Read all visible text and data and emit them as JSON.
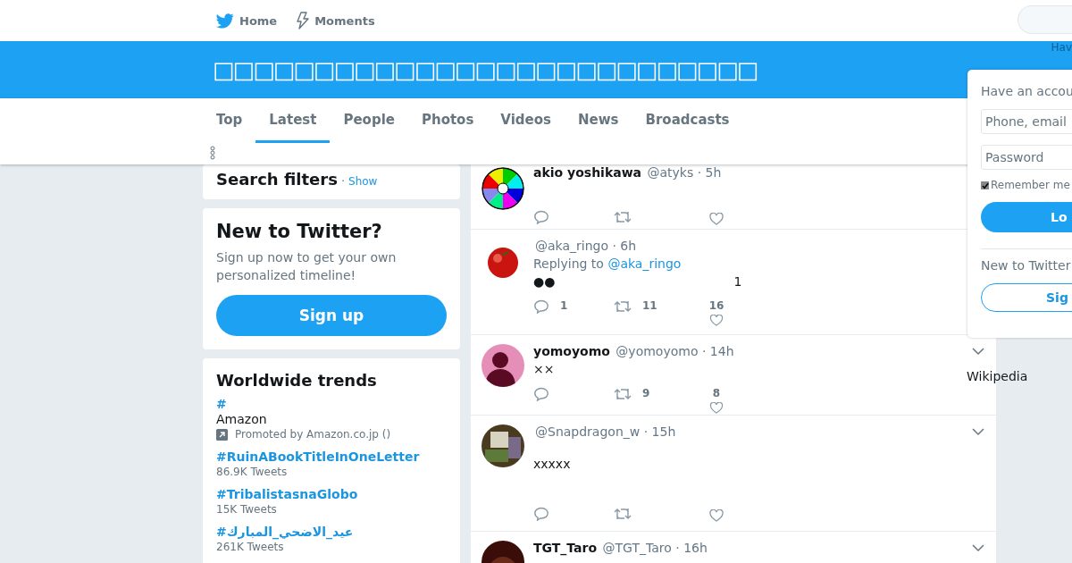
{
  "nav": {
    "items": [
      {
        "label": "Home"
      },
      {
        "label": "Moments"
      }
    ],
    "search_hint": "Hav"
  },
  "header": {
    "title": "□□□□□□□□□□□□□□□□□□□□□□□□□□□"
  },
  "tabs": [
    {
      "label": "Top",
      "selected": false
    },
    {
      "label": "Latest",
      "selected": true
    },
    {
      "label": "People",
      "selected": false
    },
    {
      "label": "Photos",
      "selected": false
    },
    {
      "label": "Videos",
      "selected": false
    },
    {
      "label": "News",
      "selected": false
    },
    {
      "label": "Broadcasts",
      "selected": false
    }
  ],
  "search_filters": {
    "title": "Search filters",
    "separator": "·",
    "link": "Show"
  },
  "signup_card": {
    "title": "New to Twitter?",
    "text": "Sign up now to get your own personalized timeline!",
    "button": "Sign up"
  },
  "trends": {
    "title": "Worldwide trends",
    "items": [
      {
        "kind": "promoted",
        "name": "#",
        "subtitle": "Amazon",
        "note": "Promoted by Amazon.co.jp ()"
      },
      {
        "kind": "trend",
        "name": "#RuinABookTitleInOneLetter",
        "count": "86.9K Tweets"
      },
      {
        "kind": "trend",
        "name": "#TribalistasnaGlobo",
        "count": "15K Tweets"
      },
      {
        "kind": "trend",
        "name": "#عيد_الاضحي_المبارك",
        "count": "261K Tweets"
      }
    ]
  },
  "tweets": [
    {
      "name": "akio yoshikawa",
      "meta": "@atyks · 5h",
      "menu": false
    },
    {
      "meta": "@aka_ringo · 6h",
      "replying": "Replying to",
      "reply_link": "@aka_ringo",
      "text": "●●",
      "aside": "1",
      "replies": "1",
      "retweets": "11",
      "likes": "16",
      "menu": false
    },
    {
      "name": "yomoyomo",
      "meta": "@yomoyomo · 14h",
      "text": "××",
      "retweets": "9",
      "likes": "8",
      "menu": true
    },
    {
      "meta": "@Snapdragon_w · 15h",
      "text": "xxxxx",
      "menu": true
    },
    {
      "name": "TGT_Taro",
      "meta": "@TGT_Taro · 16h",
      "menu": true
    }
  ],
  "login": {
    "title": "Have an accou",
    "phone_placeholder": "Phone, email",
    "password_placeholder": "Password",
    "remember": "Remember me",
    "remember_checked": true,
    "button": "Lo",
    "new_prompt": "New to Twitter",
    "signup": "Sig"
  },
  "side_note": "Wikipedia"
}
